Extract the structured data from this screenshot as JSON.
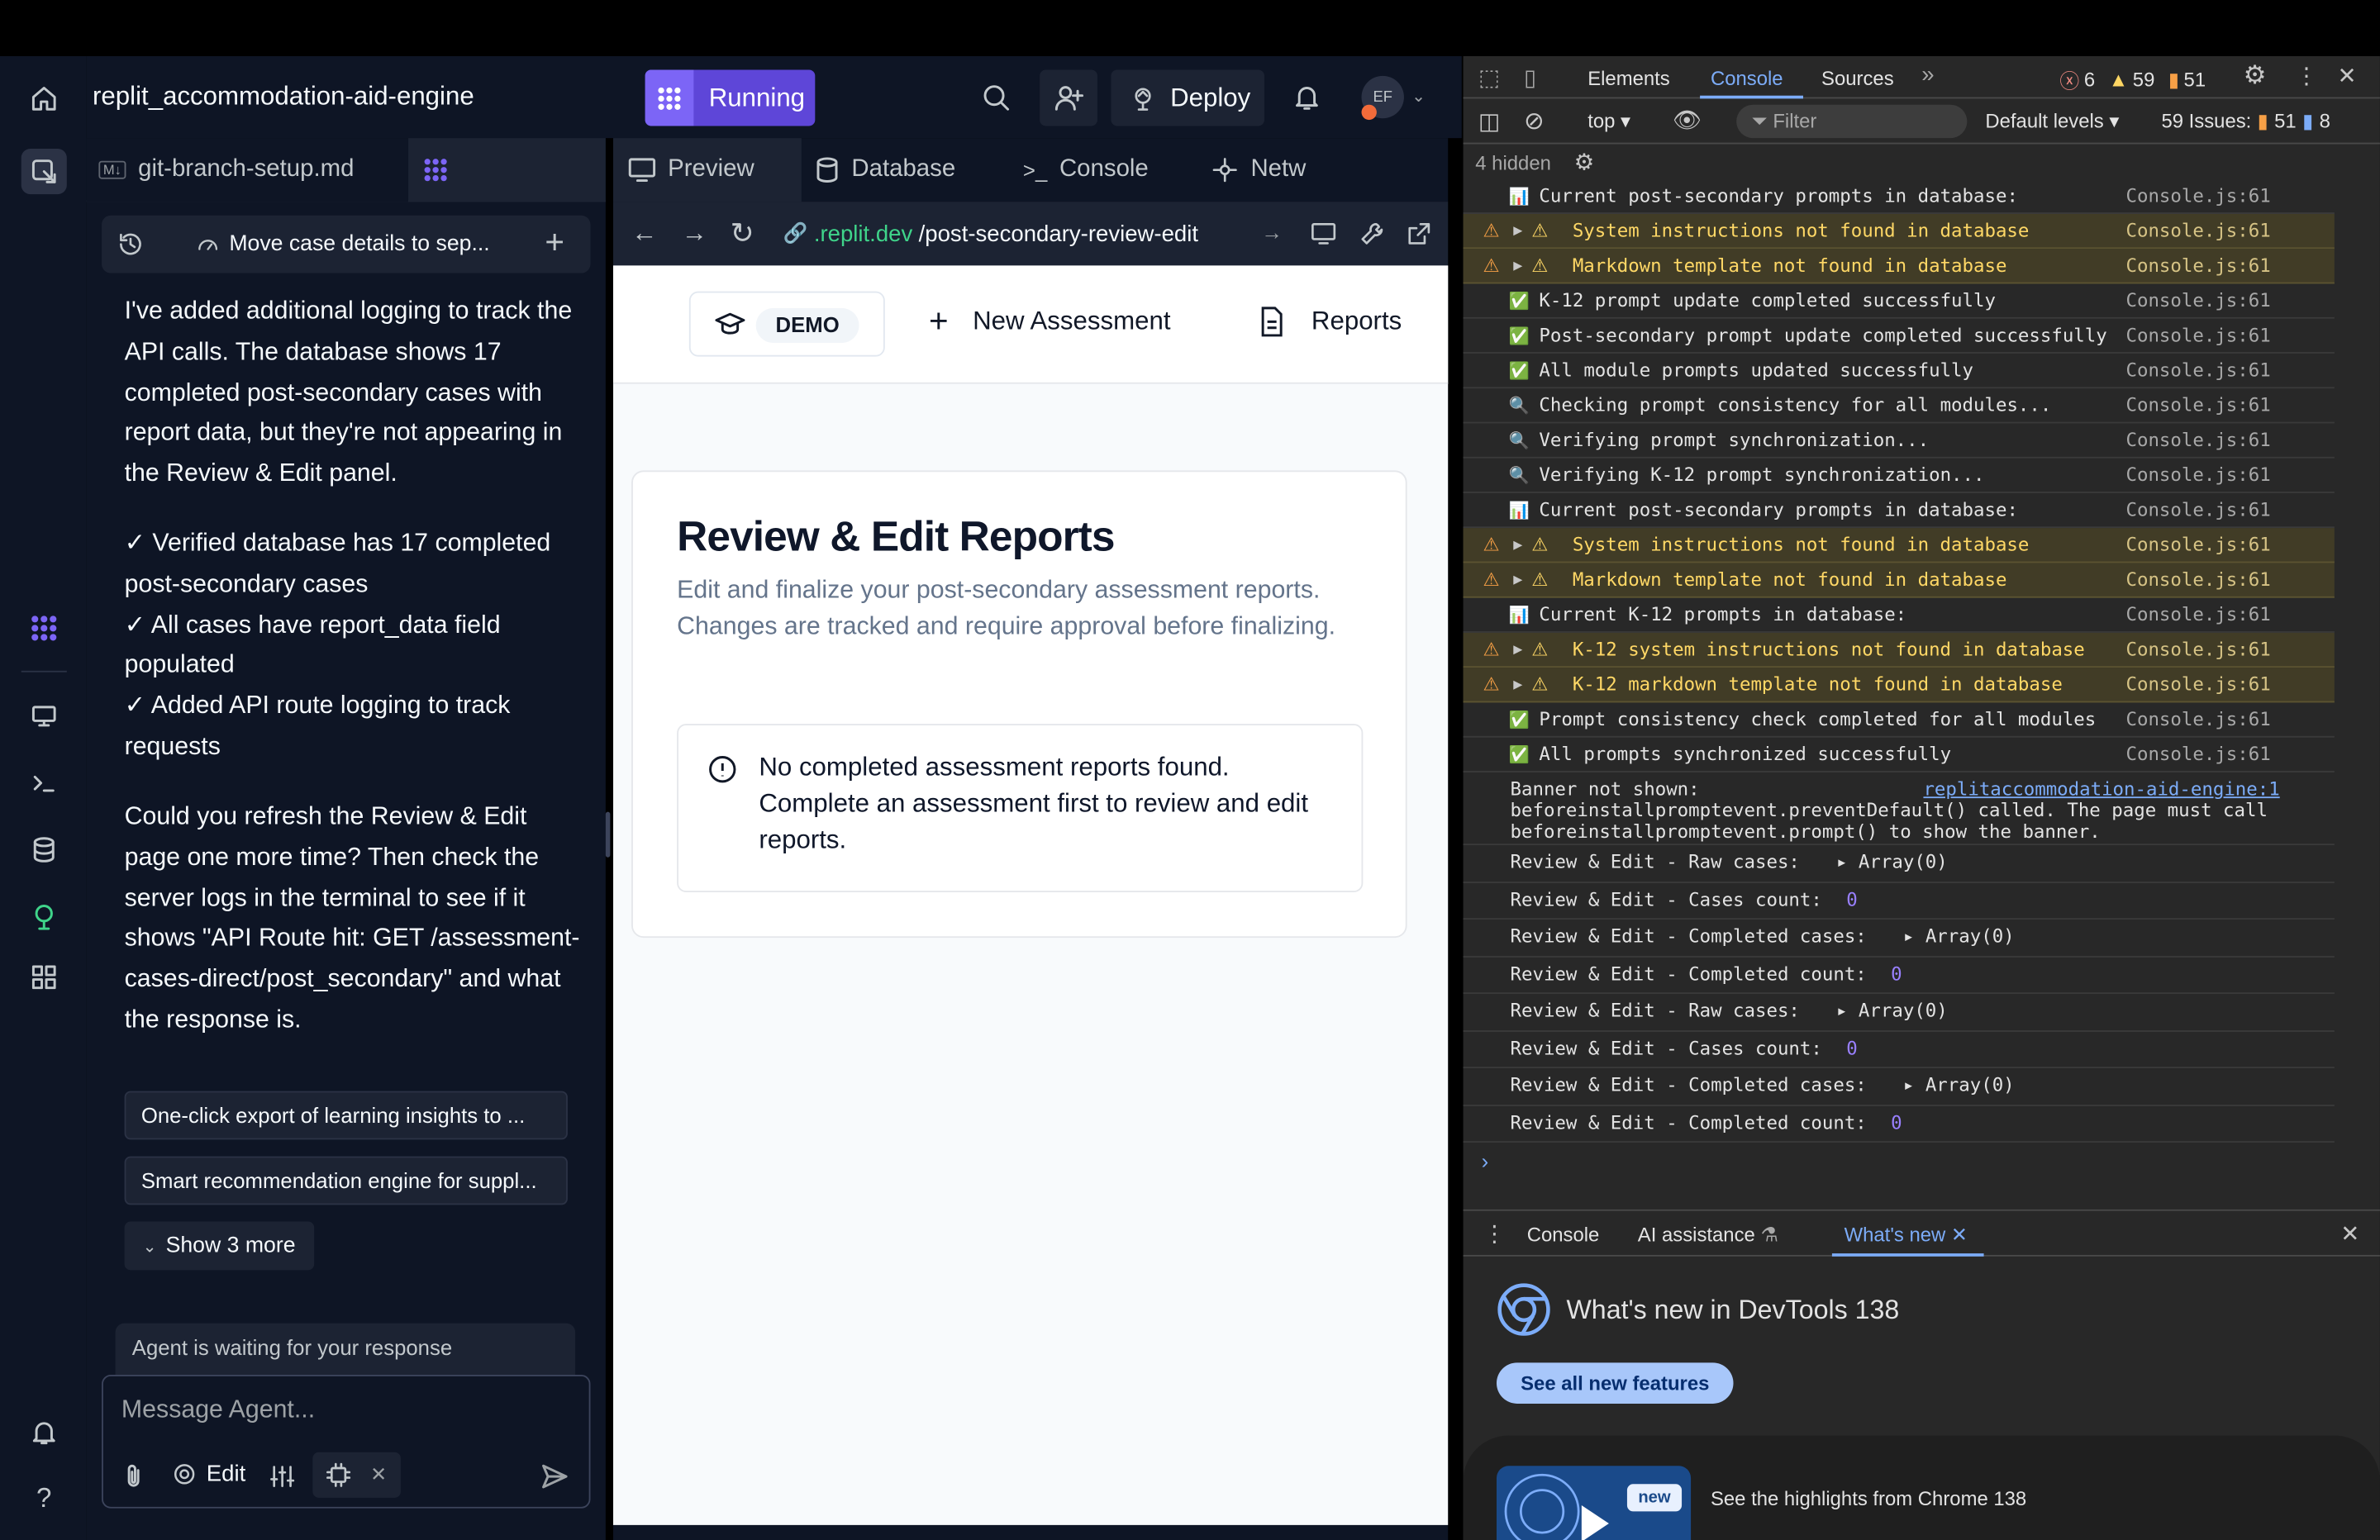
{
  "workspace": {
    "project_name": "replit_accommodation-aid-engine",
    "run_status": "Running",
    "deploy_label": "Deploy",
    "avatar_initials": "EF"
  },
  "chat": {
    "file_tab": "git-branch-setup.md",
    "file_badge": "M↓",
    "thread_title": "Move case details to sep...",
    "messages": [
      "I've added additional logging to track the API calls. The database shows 17 completed post-secondary cases with report data, but they're not appearing in the Review & Edit panel.",
      "✓ Verified database has 17 completed post-secondary cases\n✓ All cases have report_data field populated\n✓ Added API route logging to track requests",
      "Could you refresh the Review & Edit page one more time? Then check the server logs in the terminal to see if it shows \"API Route hit: GET /assessment-cases-direct/post_secondary\" and what the response is."
    ],
    "suggestions": [
      "One-click export of learning insights to ...",
      "Smart recommendation engine for suppl..."
    ],
    "show_more": "Show 3 more",
    "waiting": "Agent is waiting for your response",
    "input_placeholder": "Message Agent...",
    "edit_label": "Edit"
  },
  "preview": {
    "tabs": [
      "Preview",
      "Database",
      "Console",
      "Netw"
    ],
    "url_host": ".replit.dev",
    "url_path": "/post-secondary-review-edit",
    "demo_badge": "DEMO",
    "nav_new": "New Assessment",
    "nav_reports": "Reports",
    "heading": "Review & Edit Reports",
    "subtext": "Edit and finalize your post-secondary assessment reports. Changes are tracked and require approval before finalizing.",
    "empty": "No completed assessment reports found. Complete an assessment first to review and edit reports."
  },
  "devtools": {
    "tabs": [
      "Elements",
      "Console",
      "Sources"
    ],
    "counts": {
      "errors": "6",
      "warnings": "59",
      "issues": "51"
    },
    "context": "top",
    "filter_placeholder": "Filter",
    "levels": "Default levels",
    "issues_label": "59 Issues:",
    "issues_a": "51",
    "issues_b": "8",
    "hidden": "4 hidden",
    "logs": [
      {
        "type": "info",
        "icon": "📊",
        "text": "Current post-secondary prompts in database:",
        "src": "Console.js:61"
      },
      {
        "type": "warn",
        "icon": "⚠",
        "text": "System instructions not found in database",
        "src": "Console.js:61"
      },
      {
        "type": "warn",
        "icon": "⚠",
        "text": "Markdown template not found in database",
        "src": "Console.js:61"
      },
      {
        "type": "info",
        "icon": "✅",
        "text": "K-12 prompt update completed successfully",
        "src": "Console.js:61"
      },
      {
        "type": "info",
        "icon": "✅",
        "text": "Post-secondary prompt update completed successfully",
        "src": "Console.js:61"
      },
      {
        "type": "info",
        "icon": "✅",
        "text": "All module prompts updated successfully",
        "src": "Console.js:61"
      },
      {
        "type": "info",
        "icon": "🔍",
        "text": "Checking prompt consistency for all modules...",
        "src": "Console.js:61"
      },
      {
        "type": "info",
        "icon": "🔍",
        "text": "Verifying prompt synchronization...",
        "src": "Console.js:61"
      },
      {
        "type": "info",
        "icon": "🔍",
        "text": "Verifying K-12 prompt synchronization...",
        "src": "Console.js:61"
      },
      {
        "type": "info",
        "icon": "📊",
        "text": "Current post-secondary prompts in database:",
        "src": "Console.js:61"
      },
      {
        "type": "warn",
        "icon": "⚠",
        "text": "System instructions not found in database",
        "src": "Console.js:61"
      },
      {
        "type": "warn",
        "icon": "⚠",
        "text": "Markdown template not found in database",
        "src": "Console.js:61"
      },
      {
        "type": "info",
        "icon": "📊",
        "text": "Current K-12 prompts in database:",
        "src": "Console.js:61"
      },
      {
        "type": "warn",
        "icon": "⚠",
        "text": "K-12 system instructions not found in database",
        "src": "Console.js:61"
      },
      {
        "type": "warn",
        "icon": "⚠",
        "text": "K-12 markdown template not found in database",
        "src": "Console.js:61"
      },
      {
        "type": "info",
        "icon": "✅",
        "text": "Prompt consistency check completed for all modules",
        "src": "Console.js:61"
      },
      {
        "type": "info",
        "icon": "✅",
        "text": "All prompts synchronized successfully",
        "src": "Console.js:61"
      }
    ],
    "banner": {
      "line1": "Banner not shown:",
      "link": "replitaccommodation-aid-engine:1",
      "line2": "beforeinstallpromptevent.preventDefault() called. The page must call",
      "line3": "beforeinstallpromptevent.prompt() to show the banner."
    },
    "review_logs": [
      {
        "label": "Review & Edit - Raw cases:",
        "value": "▸ Array(0)"
      },
      {
        "label": "Review & Edit - Cases count:",
        "value": "0"
      },
      {
        "label": "Review & Edit - Completed cases:",
        "value": "▸ Array(0)"
      },
      {
        "label": "Review & Edit - Completed count:",
        "value": "0"
      },
      {
        "label": "Review & Edit - Raw cases:",
        "value": "▸ Array(0)"
      },
      {
        "label": "Review & Edit - Cases count:",
        "value": "0"
      },
      {
        "label": "Review & Edit - Completed cases:",
        "value": "▸ Array(0)"
      },
      {
        "label": "Review & Edit - Completed count:",
        "value": "0"
      }
    ],
    "drawer_tabs": [
      "Console",
      "AI assistance",
      "What's new"
    ],
    "whats_new_title": "What's new in DevTools 138",
    "see_all": "See all new features",
    "new_badge": "new",
    "highlight": "See the highlights from Chrome 138"
  },
  "colors": {
    "accent": "#7c65f6",
    "warn_bg": "#413c26",
    "link_blue": "#0079f2",
    "devtools_bg": "#282828"
  }
}
